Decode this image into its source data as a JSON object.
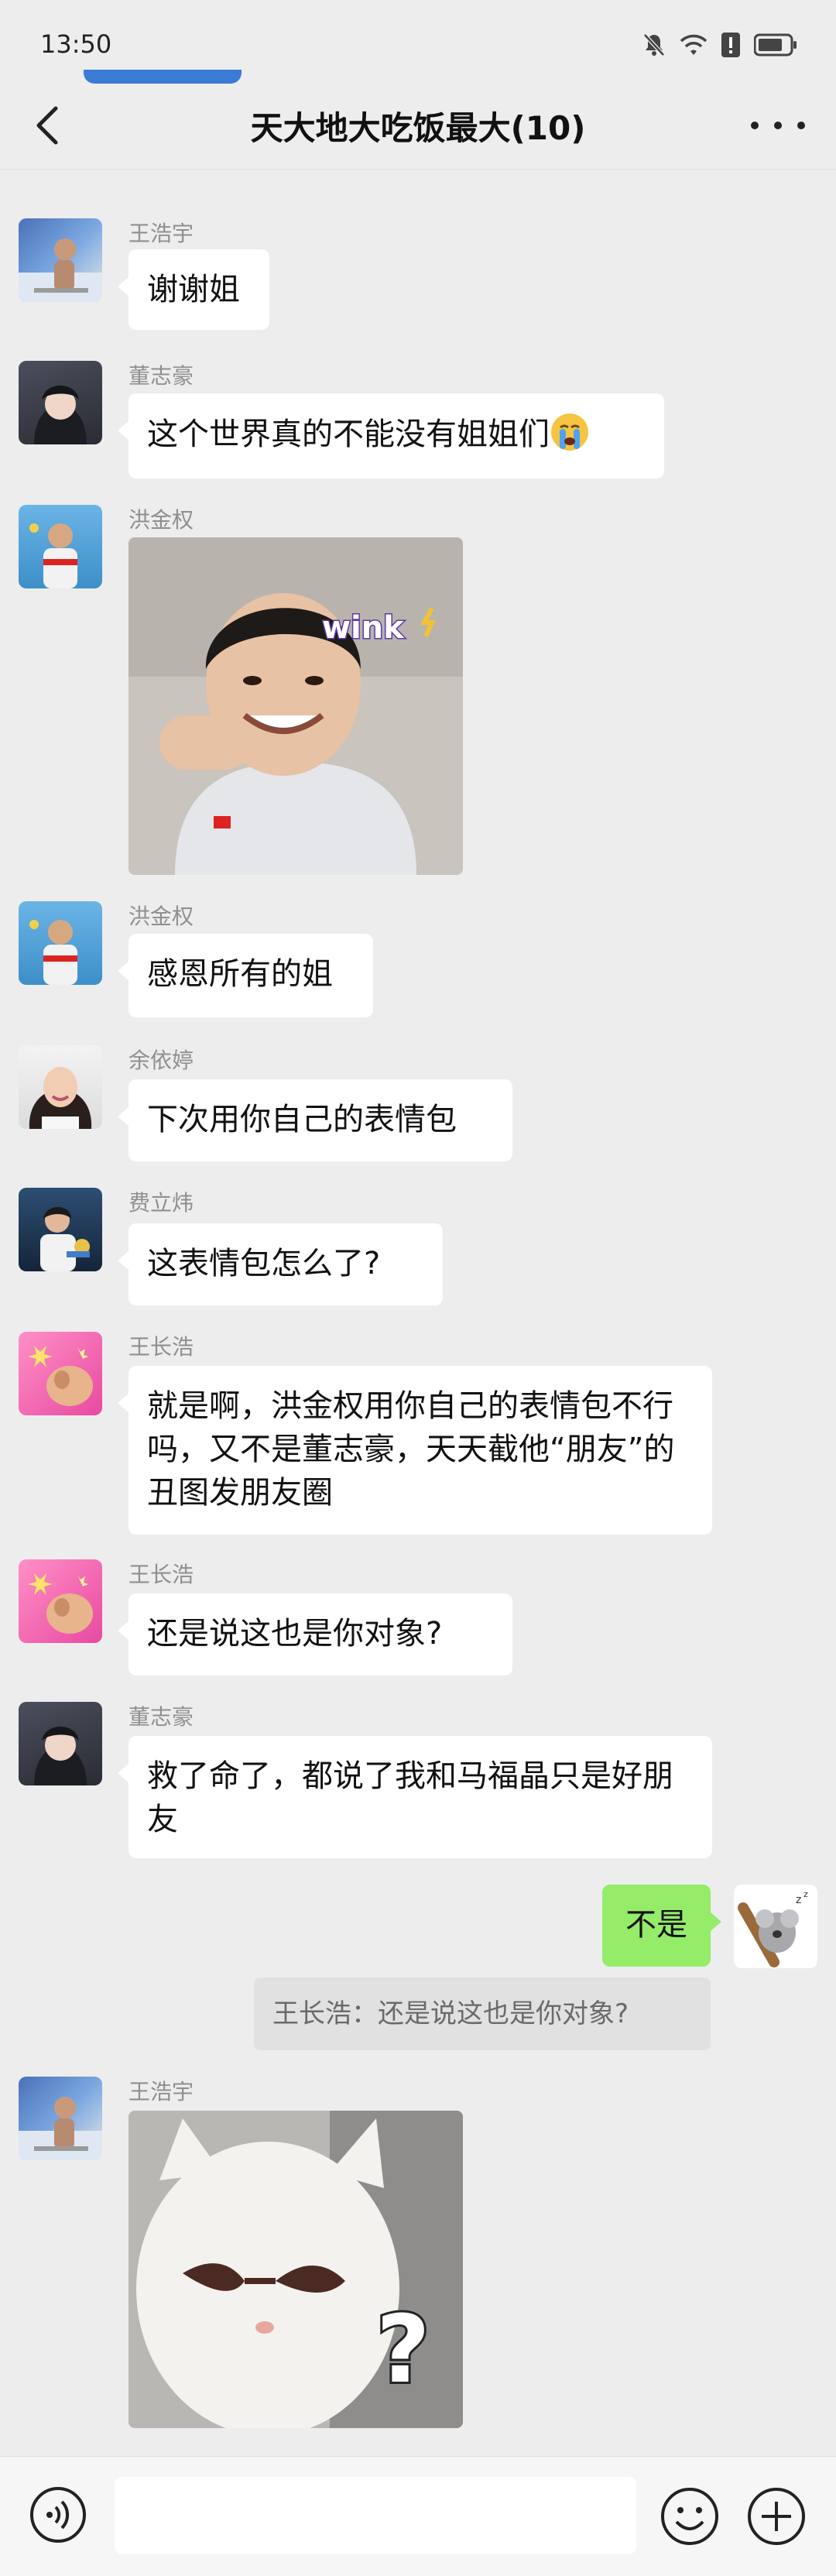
{
  "status_bar": {
    "time": "13:50"
  },
  "chat": {
    "title": "天大地大吃饭最大(10)"
  },
  "messages": [
    {
      "sender": "王浩宇",
      "text": "谢谢姐"
    },
    {
      "sender": "董志豪",
      "text": "这个世界真的不能没有姐姐们"
    },
    {
      "sender": "洪金权",
      "sticker_text": "wink"
    },
    {
      "sender": "洪金权",
      "text": "感恩所有的姐"
    },
    {
      "sender": "余依婷",
      "text": "下次用你自己的表情包"
    },
    {
      "sender": "费立炜",
      "text": "这表情包怎么了?"
    },
    {
      "sender": "王长浩",
      "text": "就是啊，洪金权用你自己的表情包不行吗，又不是董志豪，天天截他“朋友”的丑图发朋友圈"
    },
    {
      "sender": "王长浩",
      "text": "还是说这也是你对象?"
    },
    {
      "sender": "董志豪",
      "text": "救了命了，都说了我和马福晶只是好朋友"
    },
    {
      "sender": "me",
      "text": "不是"
    },
    {
      "sender": "王浩宇",
      "sticker_text": "?"
    }
  ],
  "quote": {
    "text": "王长浩：还是说这也是你对象?"
  },
  "icons": {
    "status": [
      "mute-bell-icon",
      "wifi-icon",
      "alert-icon",
      "battery-icon"
    ],
    "nav": [
      "back-icon",
      "more-icon"
    ],
    "input": [
      "voice-icon",
      "emoji-icon",
      "plus-icon"
    ]
  },
  "colors": {
    "background": "#ededed",
    "bubble": "#ffffff",
    "my_bubble": "#95ec69",
    "accent": "#3a7bd5"
  }
}
